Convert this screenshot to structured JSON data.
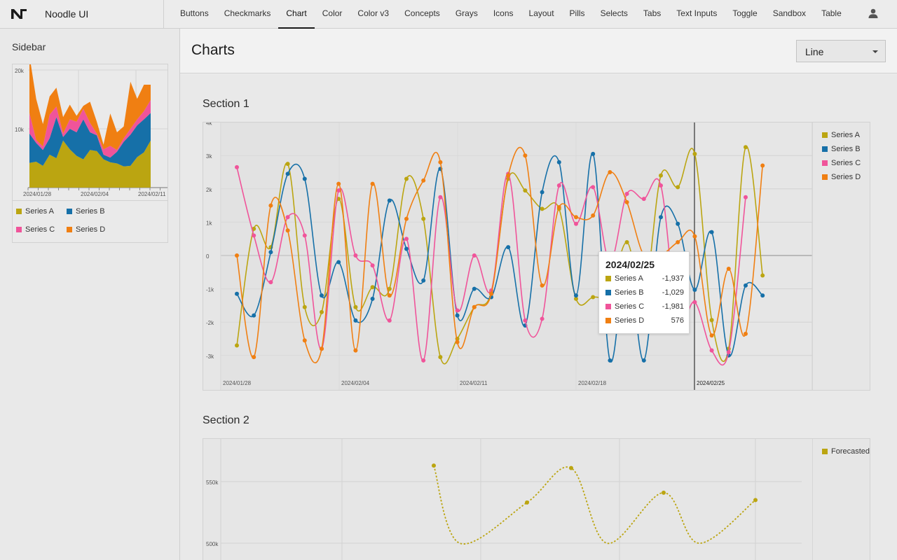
{
  "app": {
    "title": "Noodle UI"
  },
  "nav": {
    "items": [
      {
        "label": "Buttons"
      },
      {
        "label": "Checkmarks"
      },
      {
        "label": "Chart",
        "active": true
      },
      {
        "label": "Color"
      },
      {
        "label": "Color v3"
      },
      {
        "label": "Concepts"
      },
      {
        "label": "Grays"
      },
      {
        "label": "Icons"
      },
      {
        "label": "Layout"
      },
      {
        "label": "Pills"
      },
      {
        "label": "Selects"
      },
      {
        "label": "Tabs"
      },
      {
        "label": "Text Inputs"
      },
      {
        "label": "Toggle"
      },
      {
        "label": "Sandbox"
      },
      {
        "label": "Table"
      }
    ]
  },
  "sidebar": {
    "title": "Sidebar"
  },
  "header": {
    "title": "Charts",
    "select_value": "Line"
  },
  "colors": {
    "a": "#bba511",
    "b": "#1670a8",
    "c": "#f0549a",
    "d": "#f07f12"
  },
  "sections": {
    "s1_title": "Section 1",
    "s2_title": "Section 2"
  },
  "tooltip": {
    "title": "2024/02/25",
    "rows": [
      {
        "name": "Series A",
        "value": "-1,937"
      },
      {
        "name": "Series B",
        "value": "-1,029"
      },
      {
        "name": "Series C",
        "value": "-1,981"
      },
      {
        "name": "Series D",
        "value": "576"
      }
    ]
  },
  "chart_data": [
    {
      "type": "area",
      "stacked": true,
      "y_ticks": [
        "20k",
        "10k"
      ],
      "ylim": [
        0,
        20000
      ],
      "x_tick_labels": [
        "2024/01/28",
        "2024/02/04",
        "2024/02/11"
      ],
      "series": [
        {
          "name": "Series A",
          "values": [
            4200,
            4400,
            3700,
            5600,
            5000,
            8000,
            6500,
            5400,
            4800,
            6400,
            6200,
            4800,
            4300,
            4100,
            3600,
            3700,
            5200,
            6000,
            8000
          ]
        },
        {
          "name": "Series B",
          "values": [
            5000,
            3200,
            2700,
            2800,
            7000,
            600,
            3500,
            4000,
            6800,
            3000,
            2700,
            800,
            800,
            2000,
            4200,
            5300,
            5400,
            5600,
            4700
          ]
        },
        {
          "name": "Series C",
          "values": [
            3500,
            500,
            600,
            4000,
            1800,
            600,
            1600,
            1800,
            1800,
            1600,
            300,
            900,
            2000,
            300,
            600,
            1000,
            1000,
            1400,
            2200
          ]
        },
        {
          "name": "Series D",
          "values": [
            9800,
            7000,
            3800,
            3100,
            3200,
            2800,
            2500,
            1000,
            500,
            3600,
            2000,
            800,
            5500,
            3000,
            2000,
            8000,
            3500,
            4500,
            2600
          ]
        }
      ],
      "legend": [
        "Series A",
        "Series B",
        "Series C",
        "Series D"
      ]
    },
    {
      "type": "line",
      "title": "",
      "y_ticks": [
        "4k",
        "3k",
        "2k",
        "1k",
        "0",
        "-1k",
        "-2k",
        "-3k"
      ],
      "ylim": [
        -3400,
        4000
      ],
      "x_tick_labels": [
        "2024/01/28",
        "2024/02/04",
        "2024/02/11",
        "2024/02/18",
        "2024/02/25"
      ],
      "x": [
        "2024/01/28",
        "2024/01/29",
        "2024/01/30",
        "2024/01/31",
        "2024/02/01",
        "2024/02/02",
        "2024/02/03",
        "2024/02/04",
        "2024/02/05",
        "2024/02/06",
        "2024/02/07",
        "2024/02/08",
        "2024/02/09",
        "2024/02/10",
        "2024/02/11",
        "2024/02/12",
        "2024/02/13",
        "2024/02/14",
        "2024/02/15",
        "2024/02/16",
        "2024/02/17",
        "2024/02/18",
        "2024/02/19",
        "2024/02/20",
        "2024/02/21",
        "2024/02/22",
        "2024/02/23",
        "2024/02/24",
        "2024/02/25",
        "2024/02/26",
        "2024/02/27",
        "2024/02/28",
        "2024/02/29",
        "2024/03/01",
        "2024/03/02",
        "2024/03/03"
      ],
      "series": [
        {
          "name": "Series A",
          "values": [
            -2700,
            800,
            250,
            2750,
            -1550,
            -1700,
            1700,
            -1550,
            -950,
            -1000,
            2300,
            1100,
            -3050,
            -2500,
            -1550,
            -1100,
            2300,
            1950,
            1400,
            1400,
            -1300,
            -1250,
            -1100,
            400,
            -1300,
            2400,
            2050,
            3050,
            -1937,
            -2800,
            3250,
            -600,
            -350,
            0,
            0,
            0
          ]
        },
        {
          "name": "Series B",
          "values": [
            -1150,
            -1800,
            100,
            2450,
            2300,
            -1200,
            -200,
            -1950,
            -1300,
            1650,
            200,
            -750,
            2600,
            -1800,
            -1000,
            -1250,
            250,
            -2100,
            1900,
            2800,
            -1200,
            3050,
            -3150,
            0,
            -3150,
            1150,
            950,
            -1029,
            700,
            -3000,
            -900,
            -1200,
            0,
            0,
            0,
            0
          ]
        },
        {
          "name": "Series C",
          "values": [
            2650,
            600,
            -800,
            1150,
            600,
            -2800,
            1950,
            0,
            -300,
            -1950,
            500,
            -3150,
            1750,
            -1650,
            0,
            -1050,
            2450,
            -1950,
            -1900,
            2100,
            950,
            2050,
            -200,
            1850,
            1700,
            2100,
            -1981,
            -1400,
            -2850,
            -2900,
            1750,
            0,
            0,
            0,
            0,
            0
          ]
        },
        {
          "name": "Series D",
          "values": [
            0,
            -3050,
            1500,
            750,
            -2550,
            -2800,
            2150,
            -2850,
            2150,
            -1200,
            1100,
            2250,
            2800,
            -2600,
            -1550,
            -1150,
            2400,
            3000,
            -900,
            1450,
            1150,
            1200,
            2500,
            1600,
            0,
            0,
            400,
            576,
            -2400,
            -400,
            -2350,
            2700,
            0,
            0,
            0,
            0
          ]
        }
      ],
      "legend": [
        "Series A",
        "Series B",
        "Series C",
        "Series D"
      ]
    },
    {
      "type": "line",
      "title": "",
      "y_ticks": [
        "550k",
        "500k"
      ],
      "series": [
        {
          "name": "Forecasted",
          "values": [
            563000,
            500000,
            533000,
            561000,
            500000,
            541000,
            500000,
            535000
          ]
        }
      ],
      "legend": [
        "Forecasted"
      ]
    }
  ]
}
